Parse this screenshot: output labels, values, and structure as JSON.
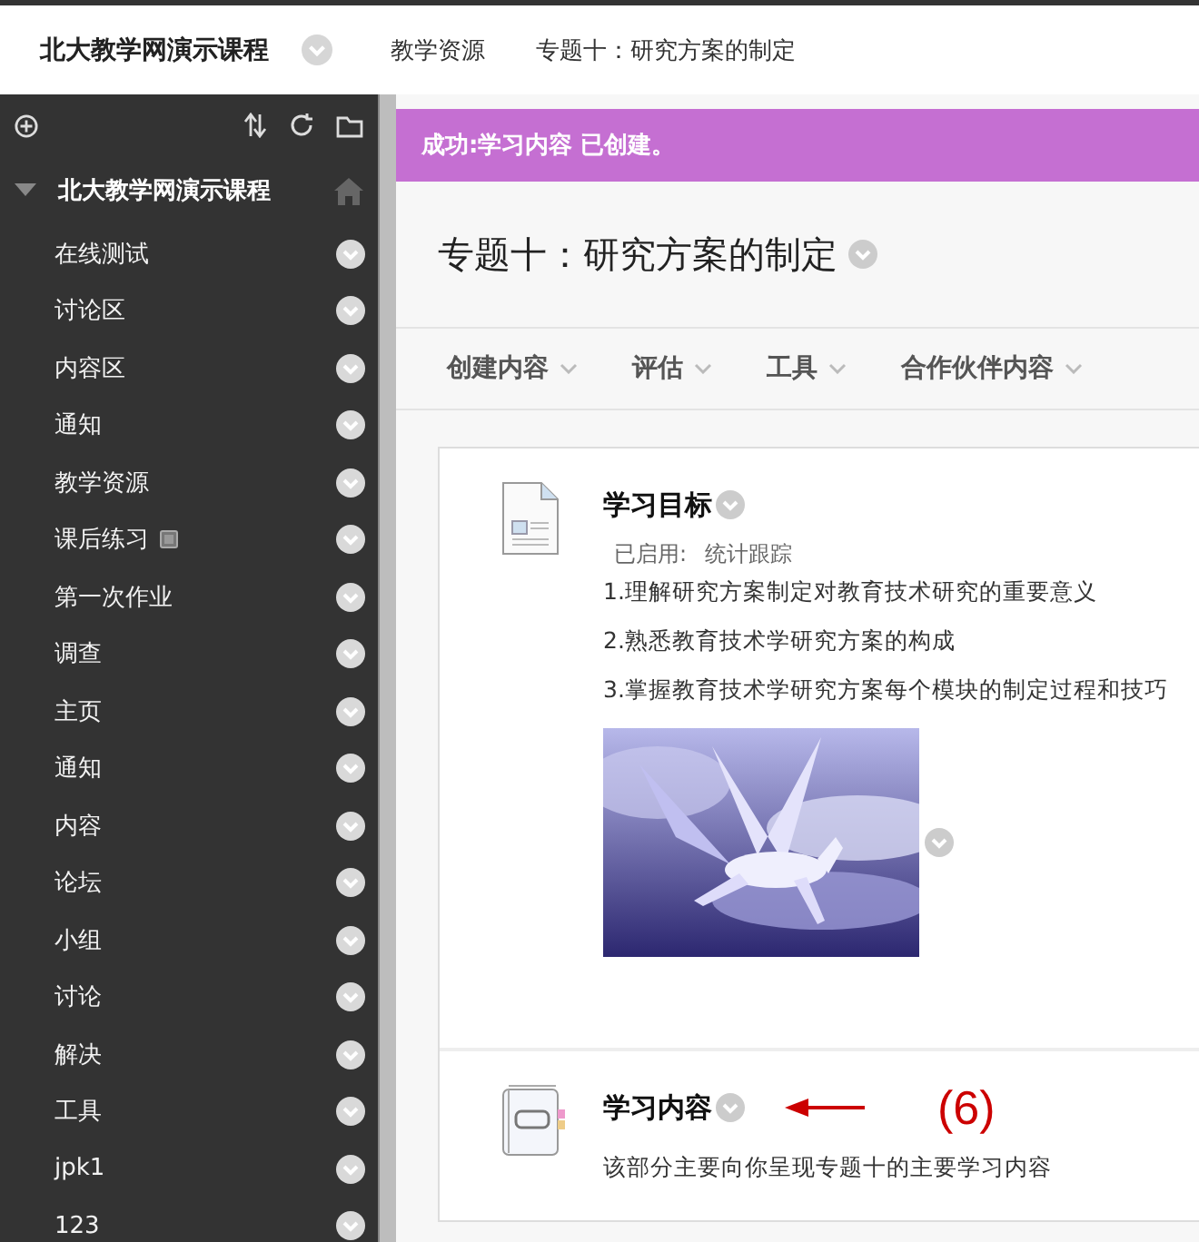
{
  "header": {
    "course_title": "北大教学网演示课程",
    "breadcrumbs": [
      "教学资源",
      "专题十：研究方案的制定"
    ]
  },
  "sidebar": {
    "course": {
      "title": "北大教学网演示课程",
      "expanded": true
    },
    "items": [
      {
        "label": "在线测试",
        "kind": "plain"
      },
      {
        "label": "讨论区",
        "kind": "plain"
      },
      {
        "label": "内容区",
        "kind": "plain"
      },
      {
        "label": "通知",
        "kind": "plain"
      },
      {
        "label": "教学资源",
        "kind": "plain"
      },
      {
        "label": "课后练习",
        "kind": "marked"
      },
      {
        "label": "第一次作业",
        "kind": "plain"
      },
      {
        "label": "调查",
        "kind": "plain"
      },
      {
        "label": "主页",
        "kind": "plain"
      },
      {
        "label": "通知",
        "kind": "plain"
      },
      {
        "label": "内容",
        "kind": "plain"
      },
      {
        "label": "论坛",
        "kind": "plain"
      },
      {
        "label": "小组",
        "kind": "plain"
      },
      {
        "label": "讨论",
        "kind": "plain"
      },
      {
        "label": "解决",
        "kind": "plain"
      },
      {
        "label": "工具",
        "kind": "plain"
      },
      {
        "label": "jpk1",
        "kind": "plain"
      },
      {
        "label": "123",
        "kind": "plain"
      }
    ]
  },
  "banner": {
    "message": "成功:学习内容 已创建。"
  },
  "page": {
    "title": "专题十：研究方案的制定"
  },
  "action_bar": [
    {
      "label": "创建内容"
    },
    {
      "label": "评估"
    },
    {
      "label": "工具"
    },
    {
      "label": "合作伙伴内容"
    }
  ],
  "content_items": [
    {
      "kind": "document",
      "title": "学习目标",
      "meta_label": "已启用:",
      "meta_value": "统计跟踪",
      "lines": [
        "1.理解研究方案制定对教育技术研究的重要意义",
        "2.熟悉教育技术学研究方案的构成",
        "3.掌握教育技术学研究方案每个模块的制定过程和技巧"
      ],
      "media": {
        "kind": "picture"
      }
    },
    {
      "kind": "module",
      "title": "学习内容",
      "annotation": "(6)",
      "lines": [
        "该部分主要向你呈现专题十的主要学习内容"
      ]
    }
  ]
}
